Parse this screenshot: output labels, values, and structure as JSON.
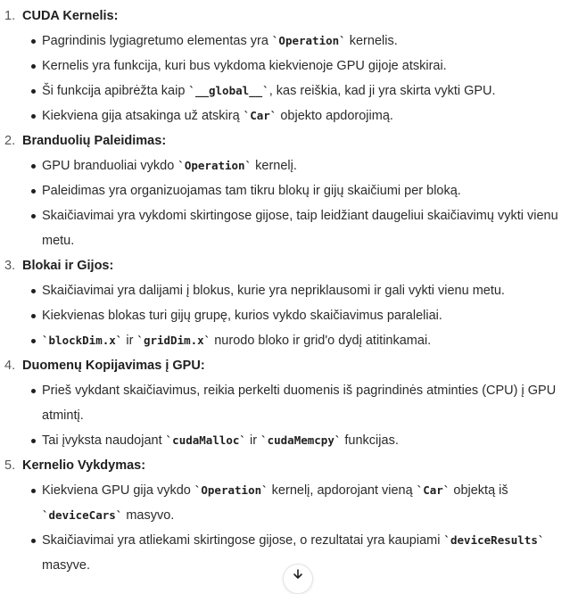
{
  "sections": [
    {
      "number": "1.",
      "title": "CUDA Kernelis:",
      "bullets": [
        [
          {
            "t": "Pagrindinis lygiagretumo elementas yra "
          },
          {
            "t": "`Operation`",
            "code": true
          },
          {
            "t": " kernelis."
          }
        ],
        [
          {
            "t": "Kernelis yra funkcija, kuri bus vykdoma kiekvienoje GPU gijoje atskirai."
          }
        ],
        [
          {
            "t": "Ši funkcija apibrėžta kaip "
          },
          {
            "t": "`__global__`",
            "code": true
          },
          {
            "t": ", kas reiškia, kad ji yra skirta vykti GPU."
          }
        ],
        [
          {
            "t": "Kiekviena gija atsakinga už atskirą "
          },
          {
            "t": "`Car`",
            "code": true
          },
          {
            "t": " objekto apdorojimą."
          }
        ]
      ]
    },
    {
      "number": "2.",
      "title": "Branduolių Paleidimas:",
      "bullets": [
        [
          {
            "t": "GPU branduoliai vykdo "
          },
          {
            "t": "`Operation`",
            "code": true
          },
          {
            "t": " kernelį."
          }
        ],
        [
          {
            "t": "Paleidimas yra organizuojamas tam tikru blokų ir gijų skaičiumi per bloką."
          }
        ],
        [
          {
            "t": "Skaičiavimai yra vykdomi skirtingose gijose, taip leidžiant daugeliui skaičiavimų vykti vienu metu."
          }
        ]
      ]
    },
    {
      "number": "3.",
      "title": "Blokai ir Gijos:",
      "bullets": [
        [
          {
            "t": "Skaičiavimai yra dalijami į blokus, kurie yra nepriklausomi ir gali vykti vienu metu."
          }
        ],
        [
          {
            "t": "Kiekvienas blokas turi gijų grupę, kurios vykdo skaičiavimus paraleliai."
          }
        ],
        [
          {
            "t": "`blockDim.x`",
            "code": true
          },
          {
            "t": " ir "
          },
          {
            "t": "`gridDim.x`",
            "code": true
          },
          {
            "t": " nurodo bloko ir grid'o dydį atitinkamai."
          }
        ]
      ]
    },
    {
      "number": "4.",
      "title": "Duomenų Kopijavimas į GPU:",
      "bullets": [
        [
          {
            "t": "Prieš vykdant skaičiavimus, reikia perkelti duomenis iš pagrindinės atminties (CPU) į GPU atmintį."
          }
        ],
        [
          {
            "t": "Tai įvyksta naudojant "
          },
          {
            "t": "`cudaMalloc`",
            "code": true
          },
          {
            "t": " ir "
          },
          {
            "t": "`cudaMemcpy`",
            "code": true
          },
          {
            "t": " funkcijas."
          }
        ]
      ]
    },
    {
      "number": "5.",
      "title": "Kernelio Vykdymas:",
      "bullets": [
        [
          {
            "t": "Kiekviena GPU gija vykdo "
          },
          {
            "t": "`Operation`",
            "code": true
          },
          {
            "t": " kernelį, apdorojant vieną "
          },
          {
            "t": "`Car`",
            "code": true
          },
          {
            "t": " objektą iš "
          },
          {
            "t": "`deviceCars`",
            "code": true
          },
          {
            "t": " masyvo."
          }
        ],
        [
          {
            "t": "Skaičiavimai yra atliekami skirtingose gijose, o rezultatai yra kaupiami "
          },
          {
            "t": "`deviceResults`",
            "code": true
          },
          {
            "t": " masyve."
          }
        ]
      ]
    }
  ],
  "scroll_button": {
    "icon": "arrow-down-icon"
  }
}
